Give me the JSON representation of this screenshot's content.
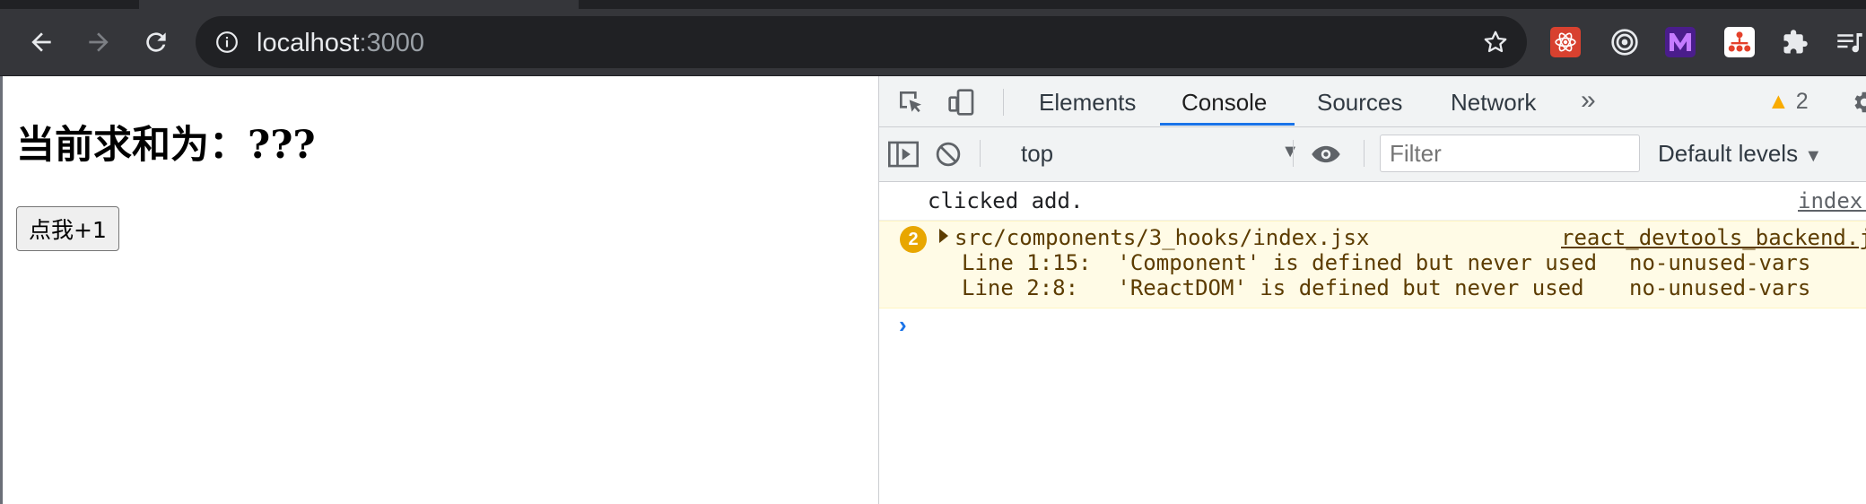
{
  "browser": {
    "address": {
      "host": "localhost",
      "port": ":3000"
    },
    "extensions": [
      "react-devtools-icon",
      "target-icon",
      "vue-m-icon",
      "hierarchy-icon",
      "puzzle-icon",
      "media-queue-icon"
    ]
  },
  "page": {
    "title": "当前求和为：???",
    "button_label": "点我+1"
  },
  "devtools": {
    "tabs": [
      "Elements",
      "Console",
      "Sources",
      "Network"
    ],
    "active_tab": "Console",
    "more_tabs": "»",
    "warning_count": "2",
    "context": "top",
    "filter_placeholder": "Filter",
    "levels": "Default levels",
    "messages": {
      "log": {
        "text": "clicked add.",
        "source": "index."
      },
      "warning": {
        "count": "2",
        "file": "src/components/3_hooks/index.jsx",
        "source": "react_devtools_backend.j",
        "lines": [
          {
            "loc": "Line 1:15:",
            "message": "'Component' is defined but never used",
            "rule": "no-unused-vars"
          },
          {
            "loc": "Line 2:8:",
            "message": "'ReactDOM' is defined but never used",
            "rule": "no-unused-vars"
          }
        ]
      }
    },
    "prompt": "›"
  },
  "colors": {
    "chrome_bg": "#35363a",
    "omnibox_bg": "#202124",
    "devtools_accent": "#1a73e8",
    "warning_bg": "#fffbe6",
    "warning_badge": "#e8a600"
  }
}
